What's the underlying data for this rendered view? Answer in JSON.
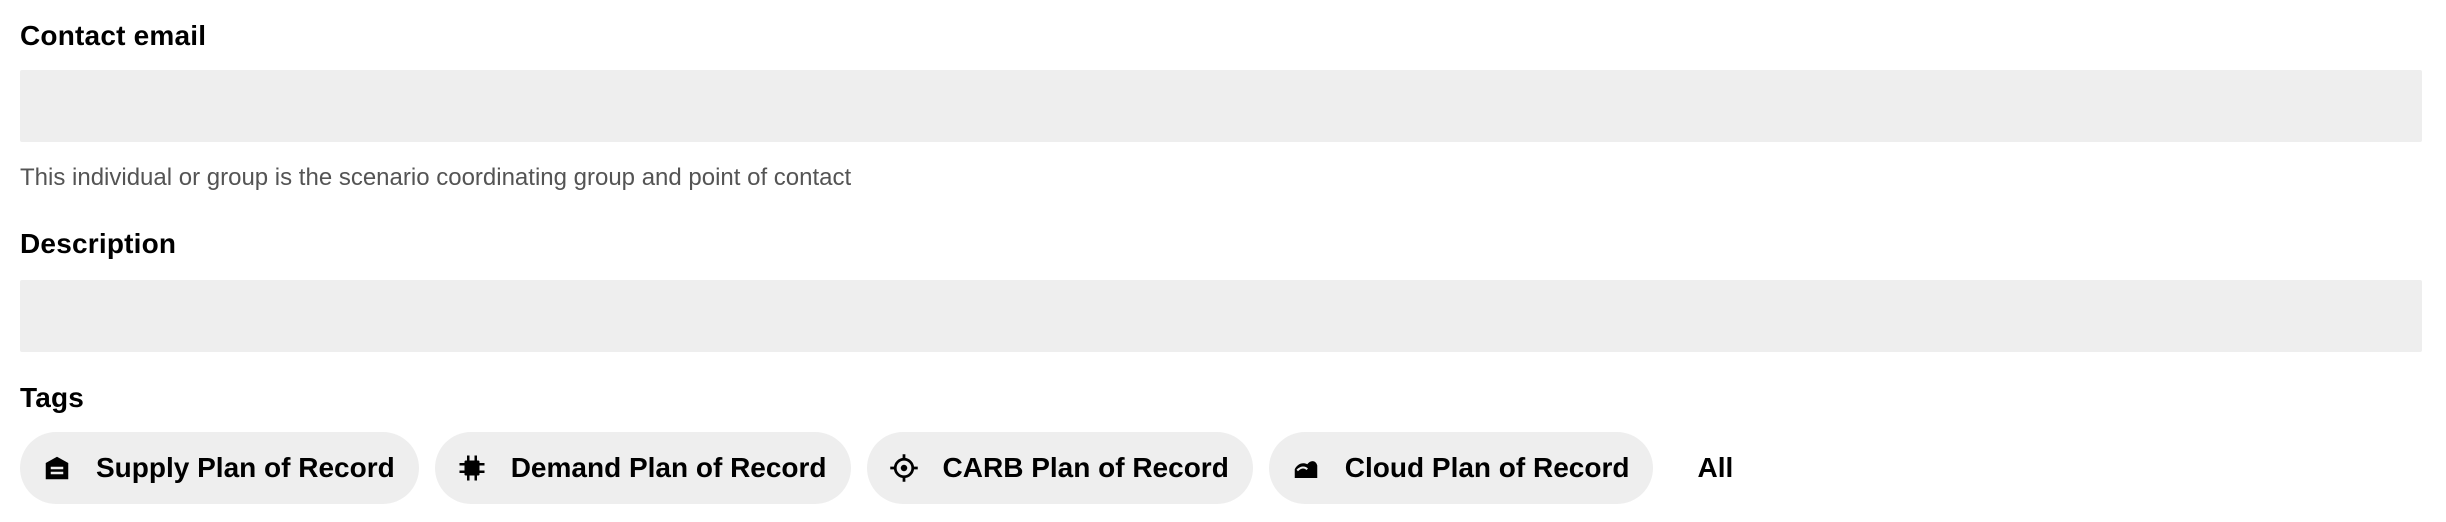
{
  "contact_email": {
    "label": "Contact email",
    "value": "",
    "placeholder": "",
    "helper_text": "This individual or group is the scenario coordinating group and point of contact"
  },
  "description": {
    "label": "Description",
    "value": "",
    "placeholder": ""
  },
  "tags": {
    "label": "Tags",
    "items": [
      {
        "label": "Supply Plan of Record",
        "icon": "warehouse-icon"
      },
      {
        "label": "Demand Plan of Record",
        "icon": "chip-icon"
      },
      {
        "label": "CARB Plan of Record",
        "icon": "crosshair-icon"
      },
      {
        "label": "Cloud Plan of Record",
        "icon": "cloud-icon"
      }
    ],
    "all_label": "All"
  }
}
